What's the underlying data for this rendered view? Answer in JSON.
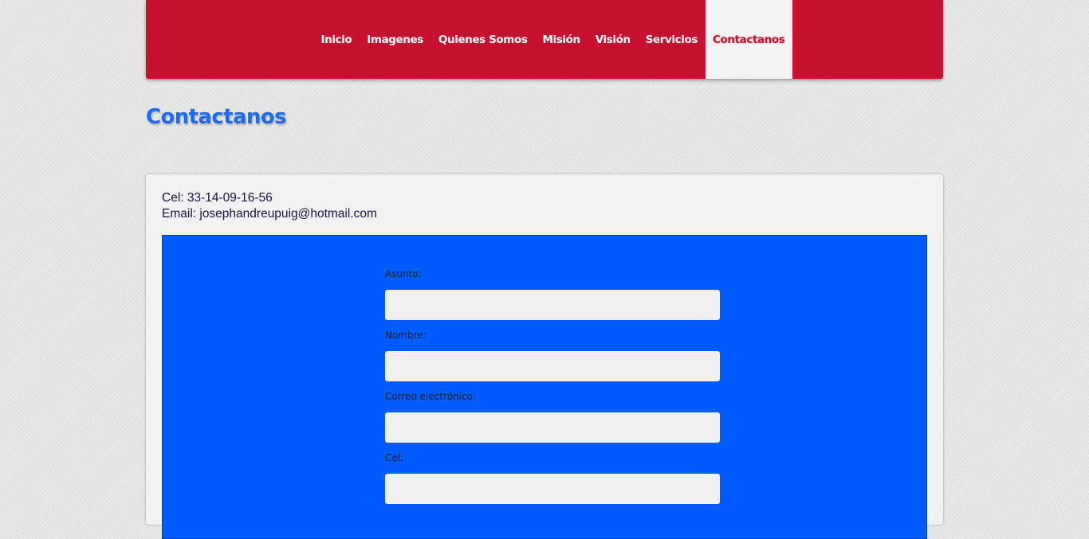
{
  "nav": {
    "items": [
      {
        "label": "Inicio"
      },
      {
        "label": "Imagenes"
      },
      {
        "label": "Quienes Somos"
      },
      {
        "label": "Misión"
      },
      {
        "label": "Visión"
      },
      {
        "label": "Servicios"
      },
      {
        "label": "Contactanos",
        "active": true
      }
    ]
  },
  "page": {
    "title": "Contactanos"
  },
  "contact": {
    "cel": "Cel: 33-14-09-16-56",
    "email": "Email: josephandreupuig@hotmail.com"
  },
  "form": {
    "fields": [
      {
        "label": "Asunto:",
        "value": ""
      },
      {
        "label": "Nombre:",
        "value": ""
      },
      {
        "label": "Correo electrónico:",
        "value": ""
      },
      {
        "label": "Cel:",
        "value": ""
      }
    ]
  },
  "colors": {
    "header": "#c41230",
    "title": "#1a6cf0",
    "form_panel": "#005cff",
    "card": "#f2f2f2"
  }
}
